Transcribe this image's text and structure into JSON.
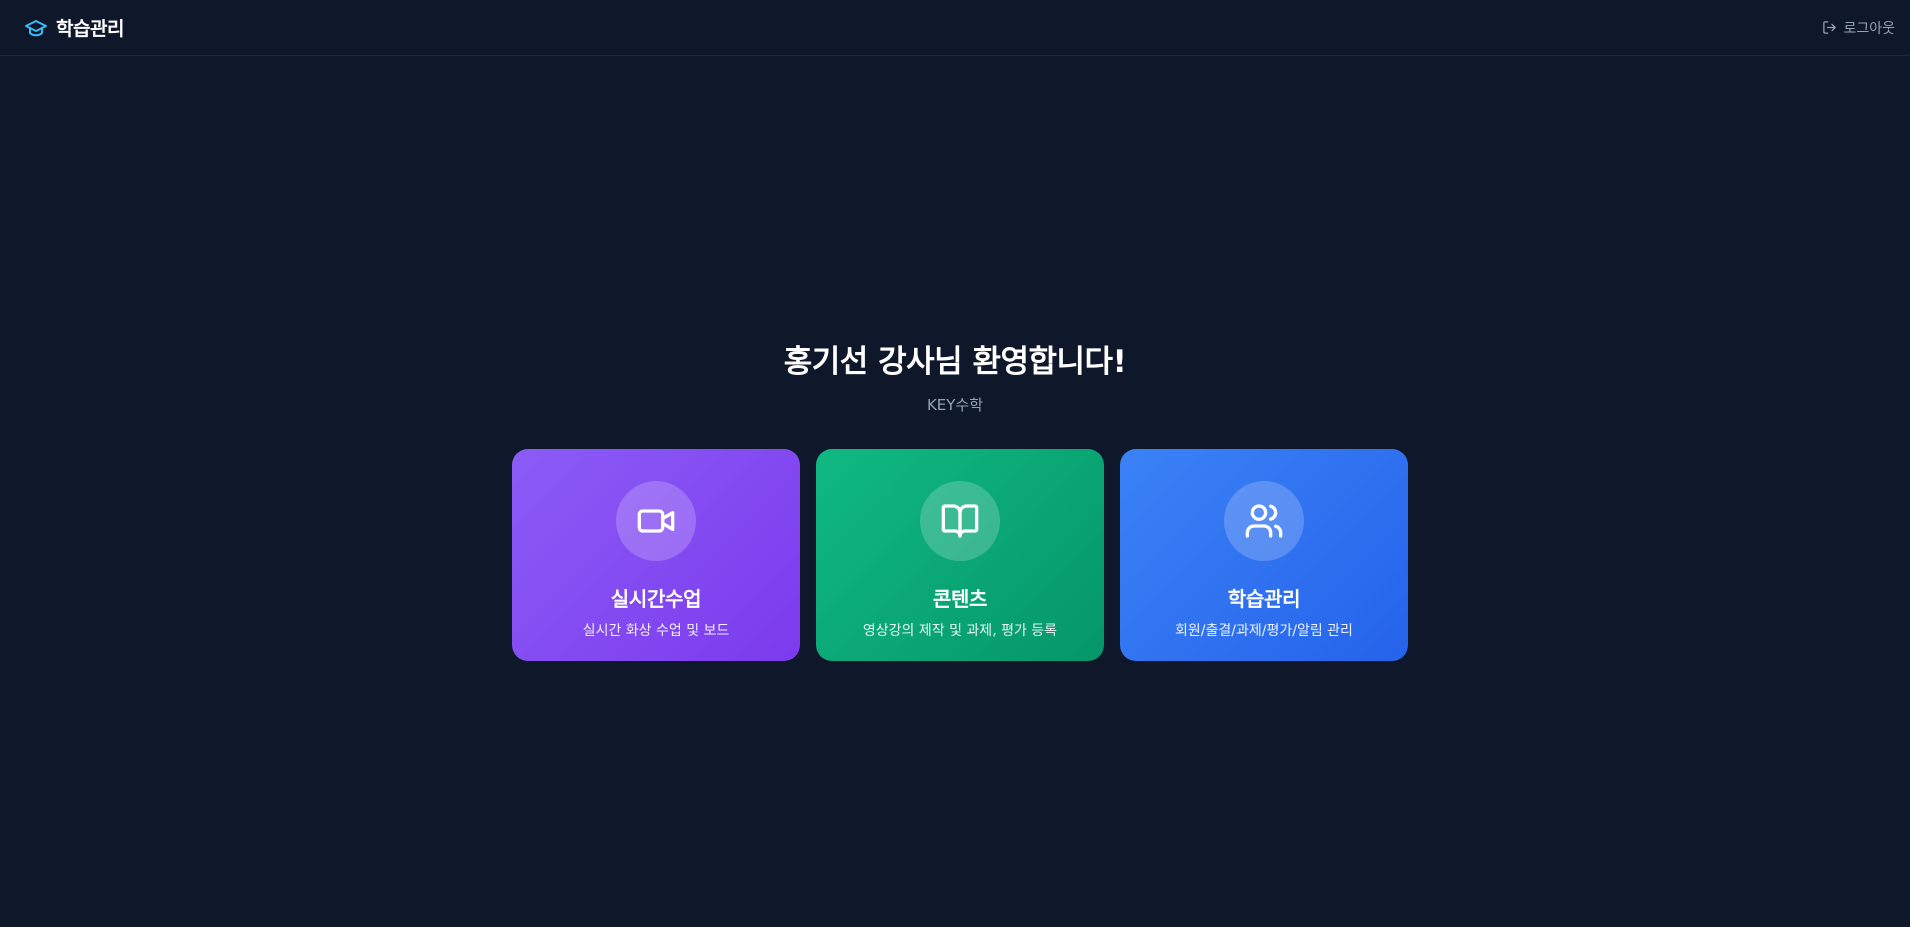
{
  "header": {
    "brand_icon": "graduation-cap-icon",
    "brand_title": "학습관리",
    "logout_icon": "log-out-icon",
    "logout_label": "로그아웃"
  },
  "hero": {
    "title": "홍기선 강사님 환영합니다!",
    "subtitle": "KEY수학"
  },
  "cards": [
    {
      "icon": "video-camera-icon",
      "title": "실시간수업",
      "description": "실시간 화상 수업 및 보드",
      "color": "#8b5cf6"
    },
    {
      "icon": "book-open-icon",
      "title": "콘텐츠",
      "description": "영상강의 제작 및 과제, 평가 등록",
      "color": "#10b981"
    },
    {
      "icon": "users-icon",
      "title": "학습관리",
      "description": "회원/출결/과제/평가/알림 관리",
      "color": "#3b82f6"
    }
  ],
  "colors": {
    "background": "#0f172a",
    "muted_text": "#94a3b8",
    "brand_icon": "#38bdf8"
  }
}
